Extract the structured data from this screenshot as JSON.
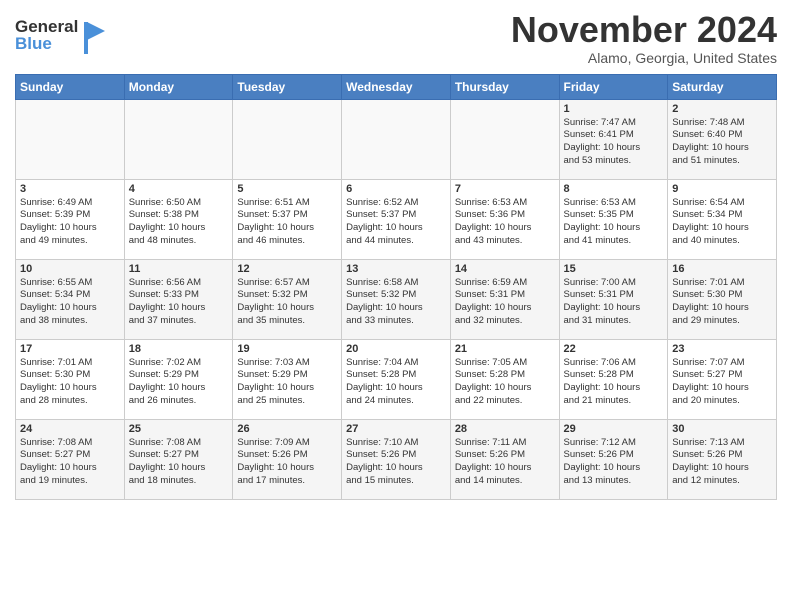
{
  "header": {
    "logo_line1": "General",
    "logo_line2": "Blue",
    "month": "November 2024",
    "location": "Alamo, Georgia, United States"
  },
  "days_of_week": [
    "Sunday",
    "Monday",
    "Tuesday",
    "Wednesday",
    "Thursday",
    "Friday",
    "Saturday"
  ],
  "weeks": [
    [
      {
        "day": "",
        "info": ""
      },
      {
        "day": "",
        "info": ""
      },
      {
        "day": "",
        "info": ""
      },
      {
        "day": "",
        "info": ""
      },
      {
        "day": "",
        "info": ""
      },
      {
        "day": "1",
        "info": "Sunrise: 7:47 AM\nSunset: 6:41 PM\nDaylight: 10 hours\nand 53 minutes."
      },
      {
        "day": "2",
        "info": "Sunrise: 7:48 AM\nSunset: 6:40 PM\nDaylight: 10 hours\nand 51 minutes."
      }
    ],
    [
      {
        "day": "3",
        "info": "Sunrise: 6:49 AM\nSunset: 5:39 PM\nDaylight: 10 hours\nand 49 minutes."
      },
      {
        "day": "4",
        "info": "Sunrise: 6:50 AM\nSunset: 5:38 PM\nDaylight: 10 hours\nand 48 minutes."
      },
      {
        "day": "5",
        "info": "Sunrise: 6:51 AM\nSunset: 5:37 PM\nDaylight: 10 hours\nand 46 minutes."
      },
      {
        "day": "6",
        "info": "Sunrise: 6:52 AM\nSunset: 5:37 PM\nDaylight: 10 hours\nand 44 minutes."
      },
      {
        "day": "7",
        "info": "Sunrise: 6:53 AM\nSunset: 5:36 PM\nDaylight: 10 hours\nand 43 minutes."
      },
      {
        "day": "8",
        "info": "Sunrise: 6:53 AM\nSunset: 5:35 PM\nDaylight: 10 hours\nand 41 minutes."
      },
      {
        "day": "9",
        "info": "Sunrise: 6:54 AM\nSunset: 5:34 PM\nDaylight: 10 hours\nand 40 minutes."
      }
    ],
    [
      {
        "day": "10",
        "info": "Sunrise: 6:55 AM\nSunset: 5:34 PM\nDaylight: 10 hours\nand 38 minutes."
      },
      {
        "day": "11",
        "info": "Sunrise: 6:56 AM\nSunset: 5:33 PM\nDaylight: 10 hours\nand 37 minutes."
      },
      {
        "day": "12",
        "info": "Sunrise: 6:57 AM\nSunset: 5:32 PM\nDaylight: 10 hours\nand 35 minutes."
      },
      {
        "day": "13",
        "info": "Sunrise: 6:58 AM\nSunset: 5:32 PM\nDaylight: 10 hours\nand 33 minutes."
      },
      {
        "day": "14",
        "info": "Sunrise: 6:59 AM\nSunset: 5:31 PM\nDaylight: 10 hours\nand 32 minutes."
      },
      {
        "day": "15",
        "info": "Sunrise: 7:00 AM\nSunset: 5:31 PM\nDaylight: 10 hours\nand 31 minutes."
      },
      {
        "day": "16",
        "info": "Sunrise: 7:01 AM\nSunset: 5:30 PM\nDaylight: 10 hours\nand 29 minutes."
      }
    ],
    [
      {
        "day": "17",
        "info": "Sunrise: 7:01 AM\nSunset: 5:30 PM\nDaylight: 10 hours\nand 28 minutes."
      },
      {
        "day": "18",
        "info": "Sunrise: 7:02 AM\nSunset: 5:29 PM\nDaylight: 10 hours\nand 26 minutes."
      },
      {
        "day": "19",
        "info": "Sunrise: 7:03 AM\nSunset: 5:29 PM\nDaylight: 10 hours\nand 25 minutes."
      },
      {
        "day": "20",
        "info": "Sunrise: 7:04 AM\nSunset: 5:28 PM\nDaylight: 10 hours\nand 24 minutes."
      },
      {
        "day": "21",
        "info": "Sunrise: 7:05 AM\nSunset: 5:28 PM\nDaylight: 10 hours\nand 22 minutes."
      },
      {
        "day": "22",
        "info": "Sunrise: 7:06 AM\nSunset: 5:28 PM\nDaylight: 10 hours\nand 21 minutes."
      },
      {
        "day": "23",
        "info": "Sunrise: 7:07 AM\nSunset: 5:27 PM\nDaylight: 10 hours\nand 20 minutes."
      }
    ],
    [
      {
        "day": "24",
        "info": "Sunrise: 7:08 AM\nSunset: 5:27 PM\nDaylight: 10 hours\nand 19 minutes."
      },
      {
        "day": "25",
        "info": "Sunrise: 7:08 AM\nSunset: 5:27 PM\nDaylight: 10 hours\nand 18 minutes."
      },
      {
        "day": "26",
        "info": "Sunrise: 7:09 AM\nSunset: 5:26 PM\nDaylight: 10 hours\nand 17 minutes."
      },
      {
        "day": "27",
        "info": "Sunrise: 7:10 AM\nSunset: 5:26 PM\nDaylight: 10 hours\nand 15 minutes."
      },
      {
        "day": "28",
        "info": "Sunrise: 7:11 AM\nSunset: 5:26 PM\nDaylight: 10 hours\nand 14 minutes."
      },
      {
        "day": "29",
        "info": "Sunrise: 7:12 AM\nSunset: 5:26 PM\nDaylight: 10 hours\nand 13 minutes."
      },
      {
        "day": "30",
        "info": "Sunrise: 7:13 AM\nSunset: 5:26 PM\nDaylight: 10 hours\nand 12 minutes."
      }
    ]
  ]
}
